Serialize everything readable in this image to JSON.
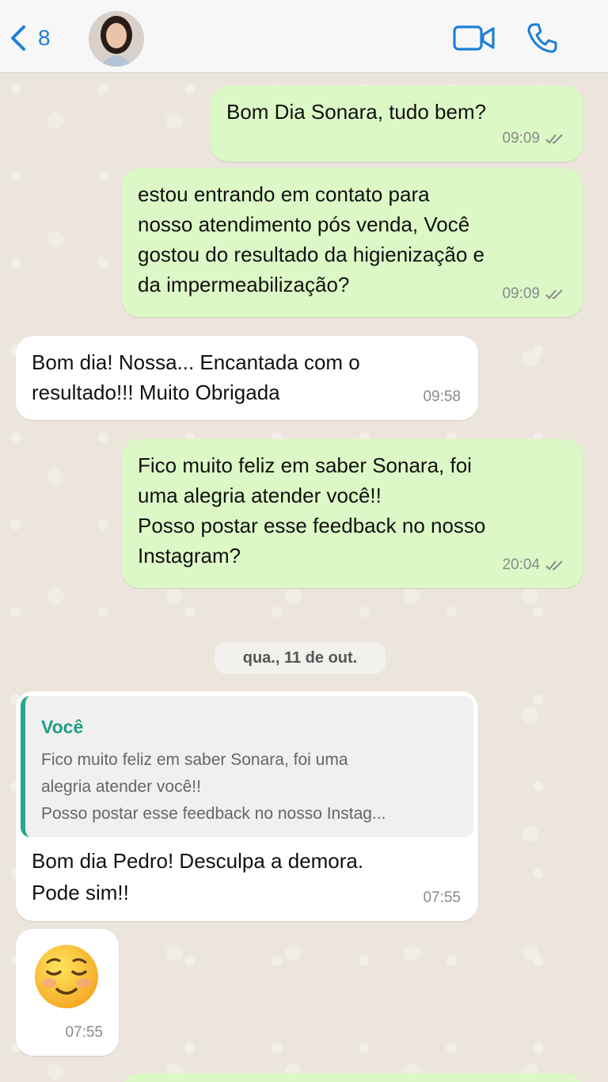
{
  "header": {
    "back_count": "8",
    "contact_name": "",
    "icons": {
      "back": "chevron-left-icon",
      "video": "video-call-icon",
      "phone": "phone-icon"
    },
    "accent_color": "#1f7fd6"
  },
  "messages": [
    {
      "dir": "out",
      "text": "Bom Dia Sonara, tudo bem?",
      "time": "09:09",
      "read_ticks": true
    },
    {
      "dir": "out",
      "text": "estou entrando em contato para\nnosso atendimento pós venda, Você\ngostou do resultado da higienização e\nda impermeabilização?",
      "time": "09:09",
      "read_ticks": true
    },
    {
      "dir": "in",
      "text": "Bom dia! Nossa... Encantada com o\nresultado!!! Muito Obrigada",
      "time": "09:58"
    },
    {
      "dir": "out",
      "text": "Fico muito feliz em saber Sonara, foi\numa alegria atender você!!\nPosso postar esse feedback no nosso\nInstagram?",
      "time": "20:04",
      "read_ticks": true
    }
  ],
  "date_separator": "qua., 11 de out.",
  "reply": {
    "quote_author": "Você",
    "quote_text": "Fico muito feliz em saber Sonara, foi uma\nalegria atender você!!\nPosso postar esse feedback no nosso Instag...",
    "text": "Bom dia Pedro! Desculpa a demora.\nPode sim!!",
    "time": "07:55"
  },
  "emoji_message": {
    "emoji": "smiling-face-icon",
    "time": "07:55"
  },
  "colors": {
    "outgoing_bubble": "#dcf8c6",
    "incoming_bubble": "#ffffff",
    "quote_bar": "#25a98c"
  }
}
